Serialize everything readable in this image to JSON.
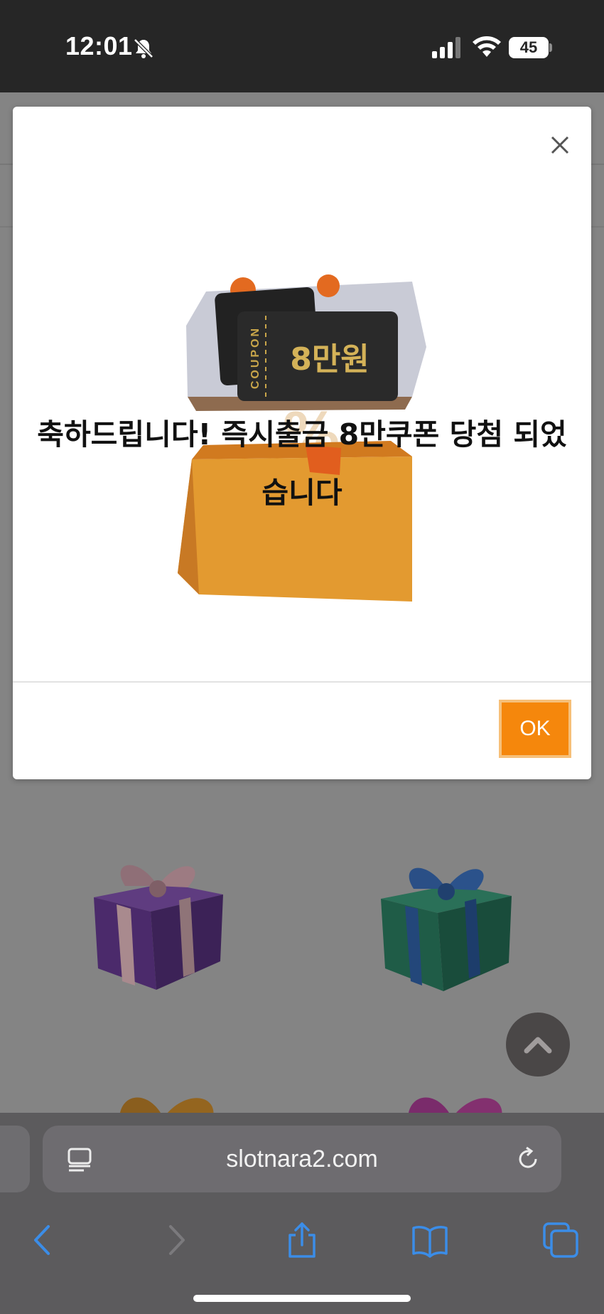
{
  "status_bar": {
    "time": "12:01",
    "battery": "45",
    "icons": [
      "bell-slash-icon",
      "signal-icon",
      "wifi-icon",
      "battery-icon"
    ]
  },
  "modal": {
    "art": {
      "coupon_label": "COUPON",
      "coupon_amount": "8만원",
      "icon": "gift-box-coupon-image"
    },
    "message": "축하드립니다! 즉시출금 8만쿠폰 당첨 되었습니다",
    "ok_label": "OK",
    "close_icon": "close-icon"
  },
  "background_gifts": [
    "purple-gift-icon",
    "green-gift-icon",
    "orange-gift-icon",
    "magenta-gift-icon"
  ],
  "browser": {
    "url": "slotnara2.com",
    "toolbar": [
      "back-icon",
      "forward-icon",
      "share-icon",
      "bookmarks-icon",
      "tabs-icon"
    ]
  },
  "colors": {
    "accent": "#f5870c",
    "ios_blue": "#3b8de8"
  }
}
